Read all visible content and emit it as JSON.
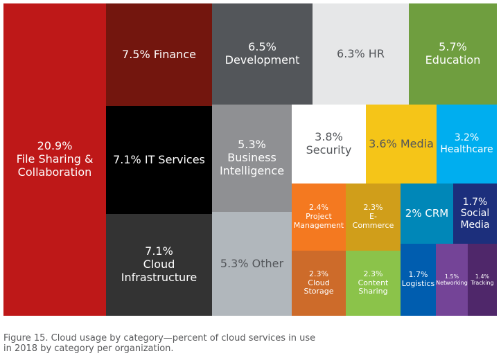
{
  "chart_data": {
    "type": "treemap",
    "title": "",
    "unit": "%",
    "caption": "Figure 15. Cloud usage by category—percent of cloud services in use in 2018 by category per organization.",
    "items": [
      {
        "name": "File Sharing & Collaboration",
        "value": 20.9,
        "label": "20.9%\nFile Sharing &\nCollaboration",
        "color": "#be1818",
        "text_color": "#ffffff"
      },
      {
        "name": "Finance",
        "value": 7.5,
        "label": "7.5% Finance",
        "color": "#73160e",
        "text_color": "#ffffff"
      },
      {
        "name": "IT Services",
        "value": 7.1,
        "label": "7.1% IT Services",
        "color": "#000000",
        "text_color": "#ffffff"
      },
      {
        "name": "Cloud Infrastructure",
        "value": 7.1,
        "label": "7.1%\nCloud\nInfrastructure",
        "color": "#333333",
        "text_color": "#ffffff"
      },
      {
        "name": "Development",
        "value": 6.5,
        "label": "6.5%\nDevelopment",
        "color": "#53565a",
        "text_color": "#ffffff"
      },
      {
        "name": "HR",
        "value": 6.3,
        "label": "6.3% HR",
        "color": "#e6e7e8",
        "text_color": "#53565a"
      },
      {
        "name": "Education",
        "value": 5.7,
        "label": "5.7%\nEducation",
        "color": "#6f9e3f",
        "text_color": "#ffffff"
      },
      {
        "name": "Business Intelligence",
        "value": 5.3,
        "label": "5.3%\nBusiness\nIntelligence",
        "color": "#8f9093",
        "text_color": "#ffffff"
      },
      {
        "name": "Other",
        "value": 5.3,
        "label": "5.3% Other",
        "color": "#b1b7bc",
        "text_color": "#53565a"
      },
      {
        "name": "Security",
        "value": 3.8,
        "label": "3.8%\nSecurity",
        "color": "#ffffff",
        "text_color": "#53565a"
      },
      {
        "name": "Media",
        "value": 3.6,
        "label": "3.6% Media",
        "color": "#f5c518",
        "text_color": "#53565a"
      },
      {
        "name": "Healthcare",
        "value": 3.2,
        "label": "3.2%\nHealthcare",
        "color": "#00aeef",
        "text_color": "#ffffff"
      },
      {
        "name": "Project Management",
        "value": 2.4,
        "label": "2.4%\nProject\nManagement",
        "color": "#f47920",
        "text_color": "#ffffff"
      },
      {
        "name": "E-Commerce",
        "value": 2.3,
        "label": "2.3%\nE-\nCommerce",
        "color": "#d09e1a",
        "text_color": "#ffffff"
      },
      {
        "name": "CRM",
        "value": 2.0,
        "label": "2% CRM",
        "color": "#0087b8",
        "text_color": "#ffffff"
      },
      {
        "name": "Social Media",
        "value": 1.7,
        "label": "1.7%\nSocial\nMedia",
        "color": "#1c2f7c",
        "text_color": "#ffffff"
      },
      {
        "name": "Cloud Storage",
        "value": 2.3,
        "label": "2.3%\nCloud\nStorage",
        "color": "#cd6b2a",
        "text_color": "#ffffff"
      },
      {
        "name": "Content Sharing",
        "value": 2.3,
        "label": "2.3%\nContent\nSharing",
        "color": "#8bc34a",
        "text_color": "#ffffff"
      },
      {
        "name": "Logistics",
        "value": 1.7,
        "label": "1.7%\nLogistics",
        "color": "#005daf",
        "text_color": "#ffffff"
      },
      {
        "name": "Networking",
        "value": 1.5,
        "label": "1.5%\nNetworking",
        "color": "#744497",
        "text_color": "#ffffff"
      },
      {
        "name": "Tracking",
        "value": 1.4,
        "label": "1.4%\nTracking",
        "color": "#4f276a",
        "text_color": "#ffffff"
      }
    ]
  }
}
